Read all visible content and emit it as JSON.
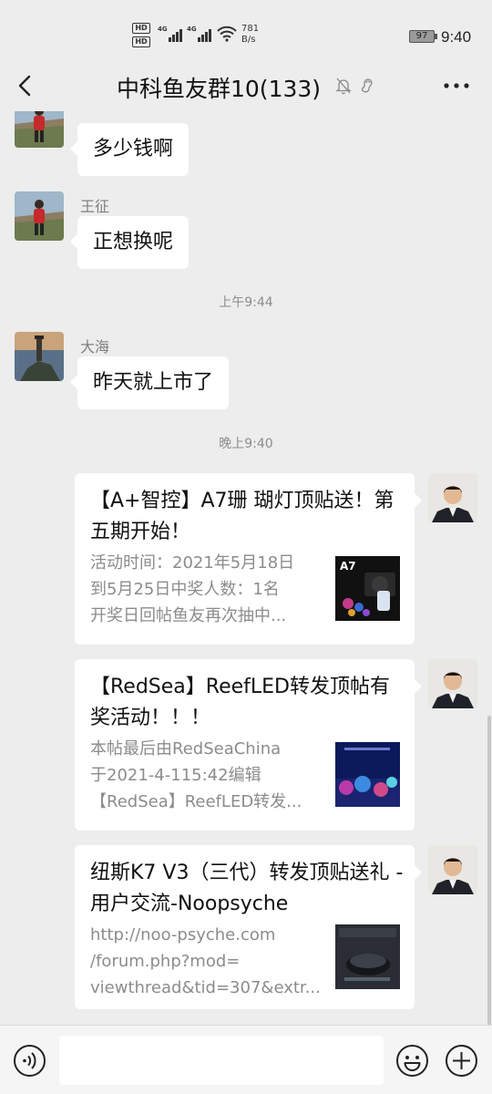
{
  "status_bar": {
    "hd1": "HD",
    "hd2": "HD",
    "net1": "4G",
    "net2": "4G",
    "speed_value": "781",
    "speed_unit": "B/s",
    "battery": "97",
    "time": "9:40"
  },
  "header": {
    "title": "中科鱼友群10(133)",
    "back_icon": "chevron-left-icon",
    "mute_icon": "bell-off-icon",
    "ear_icon": "ear-icon",
    "more_icon": "more-dots-icon"
  },
  "messages": [
    {
      "sender": "王征",
      "text": "多少钱啊"
    },
    {
      "sender": "王征",
      "text": "正想换呢"
    },
    {
      "sender": "大海",
      "text": "昨天就上市了"
    }
  ],
  "time_separators": [
    "上午9:44",
    "晚上9:40"
  ],
  "link_cards": [
    {
      "title": "【A+智控】A7珊 瑚灯顶贴送！第五期开始！",
      "desc": [
        "活动时间：2021年5月18日",
        "到5月25日中奖人数：1名",
        "开奖日回帖鱼友再次抽中..."
      ],
      "thumb_label": "A7"
    },
    {
      "title": "【RedSea】ReefLED转发顶帖有奖活动！！！",
      "desc": [
        "本帖最后由RedSeaChina",
        "于2021-4-115:42编辑",
        "【RedSea】ReefLED转发..."
      ],
      "thumb_label": ""
    },
    {
      "title": "纽斯K7 V3（三代）转发顶贴送礼 - 用户交流-Noopsyche",
      "desc": [
        "http://noo-psyche.com",
        "/forum.php?mod=",
        "viewthread&tid=307&extr..."
      ],
      "thumb_label": ""
    }
  ],
  "input_bar": {
    "placeholder": "",
    "voice_icon": "voice-icon",
    "emoji_icon": "emoji-icon",
    "plus_icon": "plus-circle-icon"
  },
  "colors": {
    "background": "#ededed",
    "bubble": "#ffffff",
    "meta_text": "#8c8c8c"
  }
}
